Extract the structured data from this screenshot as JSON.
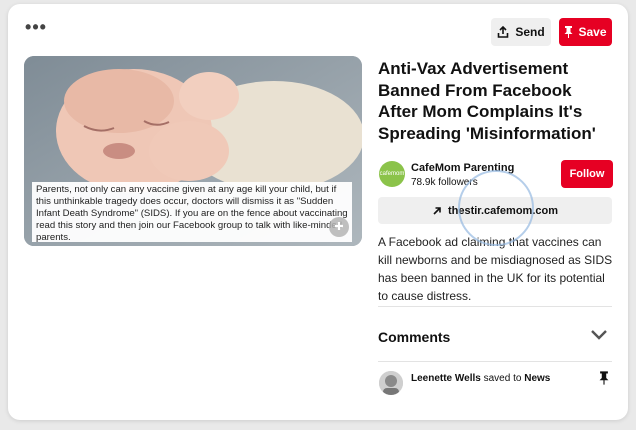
{
  "toolbar": {
    "more_icon": "ellipsis-icon",
    "send_label": "Send",
    "save_label": "Save"
  },
  "pin": {
    "image_caption": "Parents, not only can any vaccine given at any age kill your child, but if this unthinkable tragedy does occur, doctors will dismiss it as \"Sudden Infant Death Syndrome\" (SIDS). If you are on the fence about vaccinating read this story and then join our Facebook group to talk with like-minded parents.",
    "title": "Anti-Vax Advertisement Banned From Facebook After Mom Complains It's Spreading 'Misinformation'",
    "description": "A Facebook ad claiming that vaccines can kill newborns and be misdiagnosed as SIDS has been banned in the UK for its potential to cause distress."
  },
  "author": {
    "avatar_text": "cafemom",
    "name": "CafeMom Parenting",
    "followers": "78.9k followers",
    "follow_label": "Follow"
  },
  "link": {
    "icon": "arrow-up-right-icon",
    "domain": "thestir.cafemom.com"
  },
  "comments": {
    "title": "Comments"
  },
  "activity": {
    "user": "Leenette Wells",
    "action": "saved to",
    "board": "News"
  },
  "colors": {
    "accent": "#e60023",
    "button_gray": "#efefef",
    "background": "#e9e9e9"
  }
}
